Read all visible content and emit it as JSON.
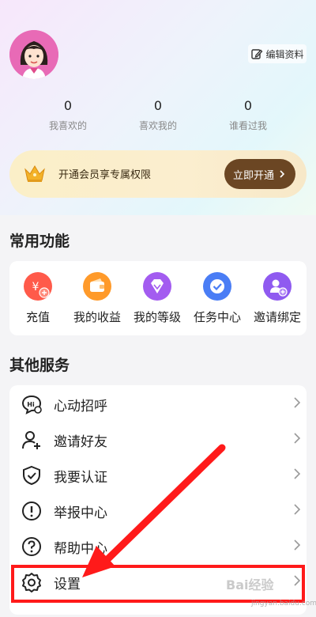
{
  "profile": {
    "edit_label": "编辑资料"
  },
  "stats": [
    {
      "count": "0",
      "label": "我喜欢的"
    },
    {
      "count": "0",
      "label": "喜欢我的"
    },
    {
      "count": "0",
      "label": "谁看过我"
    }
  ],
  "vip": {
    "text": "开通会员享专属权限",
    "button_label": "立即开通",
    "accent": "#6b4623"
  },
  "common_functions": {
    "title": "常用功能",
    "items": [
      {
        "label": "充值",
        "icon": "recharge-icon",
        "color": "#ff5a4a"
      },
      {
        "label": "我的收益",
        "icon": "wallet-icon",
        "color": "#ff9a2a"
      },
      {
        "label": "我的等级",
        "icon": "diamond-icon",
        "color": "#a35cf0"
      },
      {
        "label": "任务中心",
        "icon": "check-task-icon",
        "color": "#4a7df5"
      },
      {
        "label": "邀请绑定",
        "icon": "invite-user-icon",
        "color": "#8f5af0"
      }
    ]
  },
  "other_services": {
    "title": "其他服务",
    "items": [
      {
        "label": "心动招呼",
        "icon": "hi-chat-icon"
      },
      {
        "label": "邀请好友",
        "icon": "add-friend-icon"
      },
      {
        "label": "我要认证",
        "icon": "shield-check-icon"
      },
      {
        "label": "举报中心",
        "icon": "report-icon"
      },
      {
        "label": "帮助中心",
        "icon": "help-icon"
      },
      {
        "label": "设置",
        "icon": "settings-gear-icon"
      }
    ]
  },
  "annotation": {
    "highlight_color": "#ff1a1a",
    "watermark": "Bai经验",
    "watermark_url": "jingyan.baidu.com"
  }
}
